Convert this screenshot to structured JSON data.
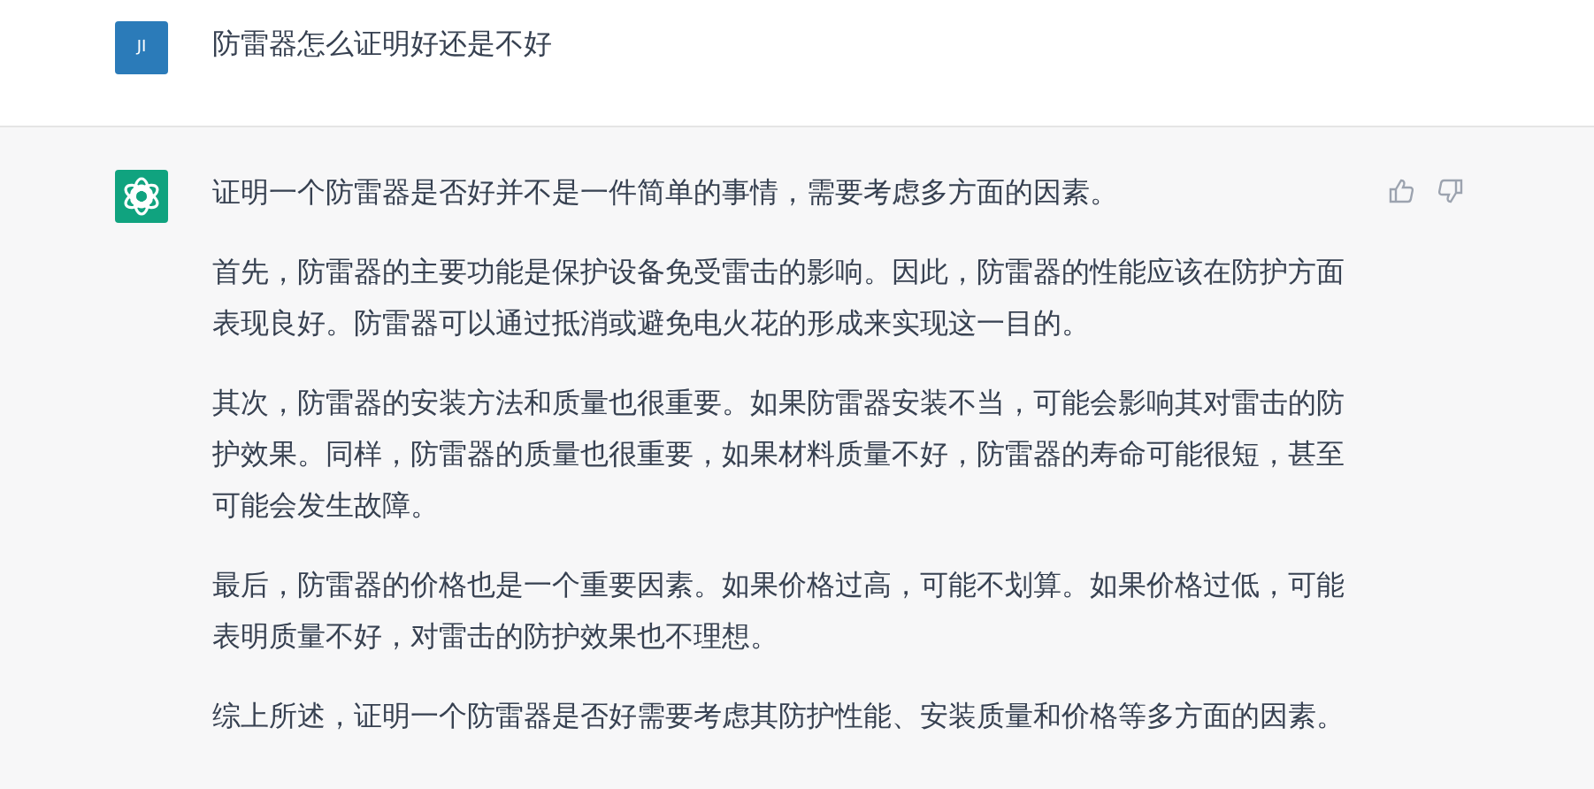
{
  "messages": [
    {
      "kind": "user",
      "avatar": "JI",
      "paragraphs": [
        "防雷器怎么证明好还是不好"
      ]
    },
    {
      "kind": "assistant",
      "paragraphs": [
        "证明一个防雷器是否好并不是一件简单的事情，需要考虑多方面的因素。",
        "首先，防雷器的主要功能是保护设备免受雷击的影响。因此，防雷器的性能应该在防护方面表现良好。防雷器可以通过抵消或避免电火花的形成来实现这一目的。",
        "其次，防雷器的安装方法和质量也很重要。如果防雷器安装不当，可能会影响其对雷击的防护效果。同样，防雷器的质量也很重要，如果材料质量不好，防雷器的寿命可能很短，甚至可能会发生故障。",
        "最后，防雷器的价格也是一个重要因素。如果价格过高，可能不划算。如果价格过低，可能表明质量不好，对雷击的防护效果也不理想。",
        "综上所述，证明一个防雷器是否好需要考虑其防护性能、安装质量和价格等多方面的因素。"
      ]
    }
  ]
}
